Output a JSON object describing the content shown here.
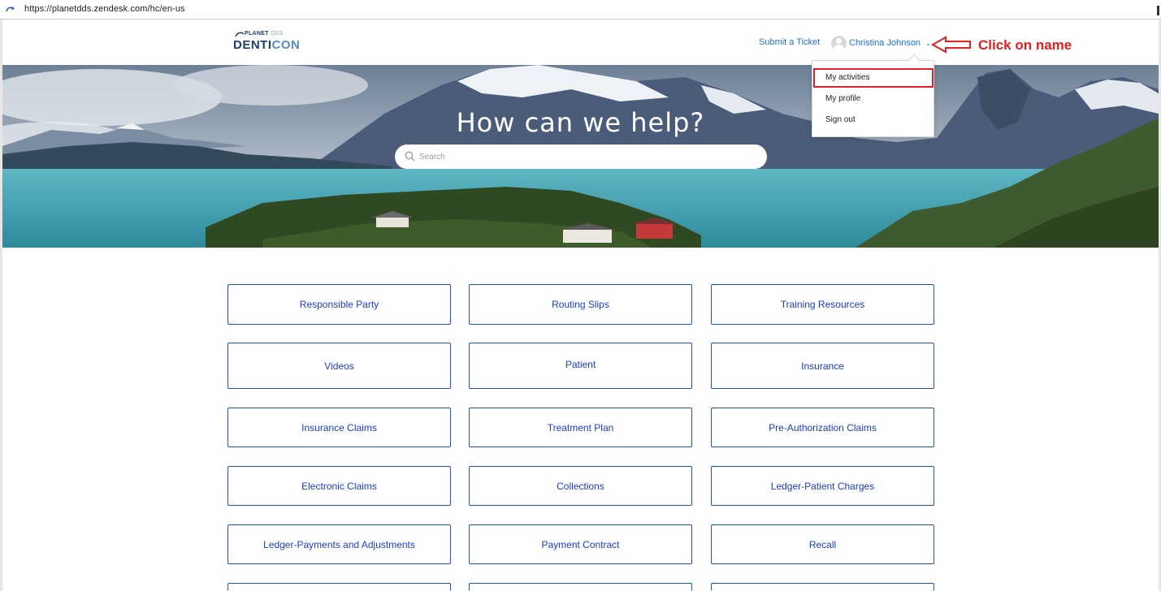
{
  "browser": {
    "url": "https://planetdds.zendesk.com/hc/en-us"
  },
  "header": {
    "logo": {
      "top": "PLANET",
      "top_suffix": "DDS",
      "brand_main": "DENTI",
      "brand_accent": "CON"
    },
    "submit_ticket": "Submit a Ticket",
    "user_name": "Christina Johnson"
  },
  "annotation": {
    "text": "Click on name",
    "color": "#e02020"
  },
  "hero": {
    "title": "How can we help?",
    "search_placeholder": "Search"
  },
  "dropdown": {
    "items": [
      "My activities",
      "My profile",
      "Sign out"
    ],
    "highlighted": "My activities"
  },
  "categories": [
    [
      "Responsible Party",
      "Routing Slips",
      "Training Resources"
    ],
    [
      "Videos",
      "Patient",
      "Insurance"
    ],
    [
      "Insurance Claims",
      "Treatment Plan",
      "Pre-Authorization Claims"
    ],
    [
      "Electronic Claims",
      "Collections",
      "Ledger-Patient Charges"
    ],
    [
      "Ledger-Payments and Adjustments",
      "Payment Contract",
      "Recall"
    ],
    [
      "",
      "",
      ""
    ]
  ],
  "colors": {
    "link": "#1a73d9",
    "tile_border": "#1a4fd6",
    "tile_text": "#1a3cc9",
    "brand_dark": "#1d3d6b"
  }
}
